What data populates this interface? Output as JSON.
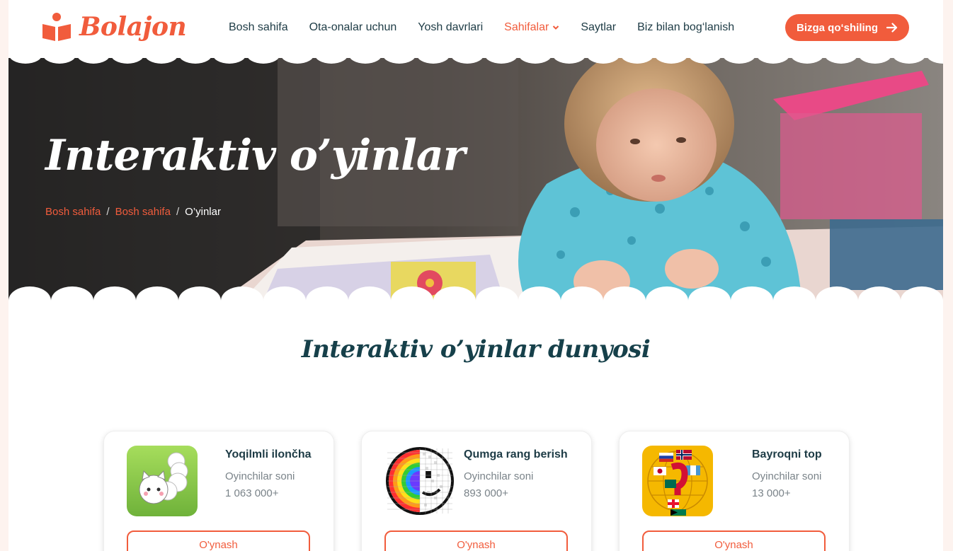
{
  "brand": {
    "name": "Bolajon",
    "accent": "#f15c3c",
    "dark": "#1d3b45"
  },
  "nav": {
    "items": [
      {
        "label": "Bosh sahifa"
      },
      {
        "label": "Ota-onalar uchun"
      },
      {
        "label": "Yosh davrlari"
      },
      {
        "label": "Sahifalar",
        "active": true,
        "icon": "chevron-down-icon"
      },
      {
        "label": "Saytlar"
      },
      {
        "label": "Biz bilan bog‘lanish"
      }
    ],
    "cta_label": "Bizga qo‘shiling",
    "cta_icon": "arrow-right-icon"
  },
  "hero": {
    "title": "Interaktiv o’yinlar",
    "breadcrumb": [
      "Bosh sahifa",
      "Bosh sahifa",
      "O’yinlar"
    ]
  },
  "section": {
    "title": "Interaktiv o’yinlar dunyosi"
  },
  "games": [
    {
      "name": "Yoqilmli ilončha",
      "subtitle": "Oyinchilar soni",
      "count": "1 063 000+",
      "button": "O'ynash"
    },
    {
      "name": "Qumga rang berish",
      "subtitle": "Oyinchilar soni",
      "count": "893 000+",
      "button": "O'ynash"
    },
    {
      "name": "Bayroqni top",
      "subtitle": "Oyinchilar soni",
      "count": "13 000+",
      "button": "O'ynash"
    }
  ]
}
